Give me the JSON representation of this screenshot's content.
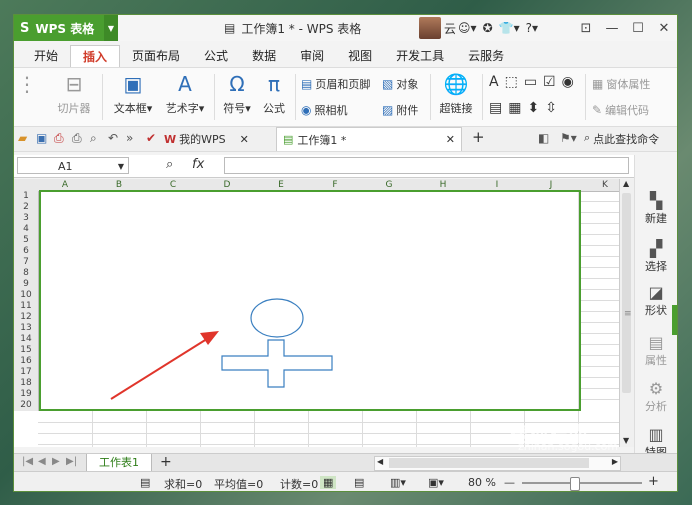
{
  "app": {
    "name": "WPS 表格",
    "logo": "S"
  },
  "title": {
    "text": "工作簿1 * - WPS 表格"
  },
  "user": {
    "name": "云"
  },
  "window_controls": {
    "minimize": "—",
    "restore": "☐",
    "close": "✕"
  },
  "menu_tabs": [
    "开始",
    "插入",
    "页面布局",
    "公式",
    "数据",
    "审阅",
    "视图",
    "开发工具",
    "云服务"
  ],
  "active_tab": "插入",
  "ribbon": {
    "slicer": "切片器",
    "textbox": "文本框",
    "wordart": "艺术字",
    "symbol": "符号",
    "formula": "公式",
    "header_footer": "页眉和页脚",
    "camera": "照相机",
    "object": "对象",
    "attachment": "附件",
    "hyperlink": "超链接",
    "form_props": "窗体属性",
    "edit_code": "编辑代码"
  },
  "doc_tabs": {
    "my_wps": "我的WPS",
    "current": "工作簿1 *",
    "find_cmd": "点此查找命令"
  },
  "formula_bar": {
    "cell_ref": "A1",
    "fx": "fx"
  },
  "columns": [
    "A",
    "B",
    "C",
    "D",
    "E",
    "F",
    "G",
    "H",
    "I",
    "J",
    "K"
  ],
  "rows": [
    "1",
    "2",
    "3",
    "4",
    "5",
    "6",
    "7",
    "8",
    "9",
    "10",
    "11",
    "12",
    "13",
    "14",
    "15",
    "16",
    "17",
    "18",
    "19",
    "20"
  ],
  "sidebar": [
    "新建",
    "选择",
    "形状",
    "属性",
    "分析",
    "特图"
  ],
  "sheet": {
    "name": "工作表1",
    "add": "+"
  },
  "status": {
    "sum": "求和=0",
    "avg": "平均值=0",
    "count": "计数=0",
    "zoom": "80 %"
  },
  "watermark": {
    "main": "搜狗指南",
    "url": "zhinan.sogou.com"
  },
  "colors": {
    "accent": "#4a9e2f",
    "arrow": "#e0352b",
    "shape": "#3a7fc0"
  }
}
